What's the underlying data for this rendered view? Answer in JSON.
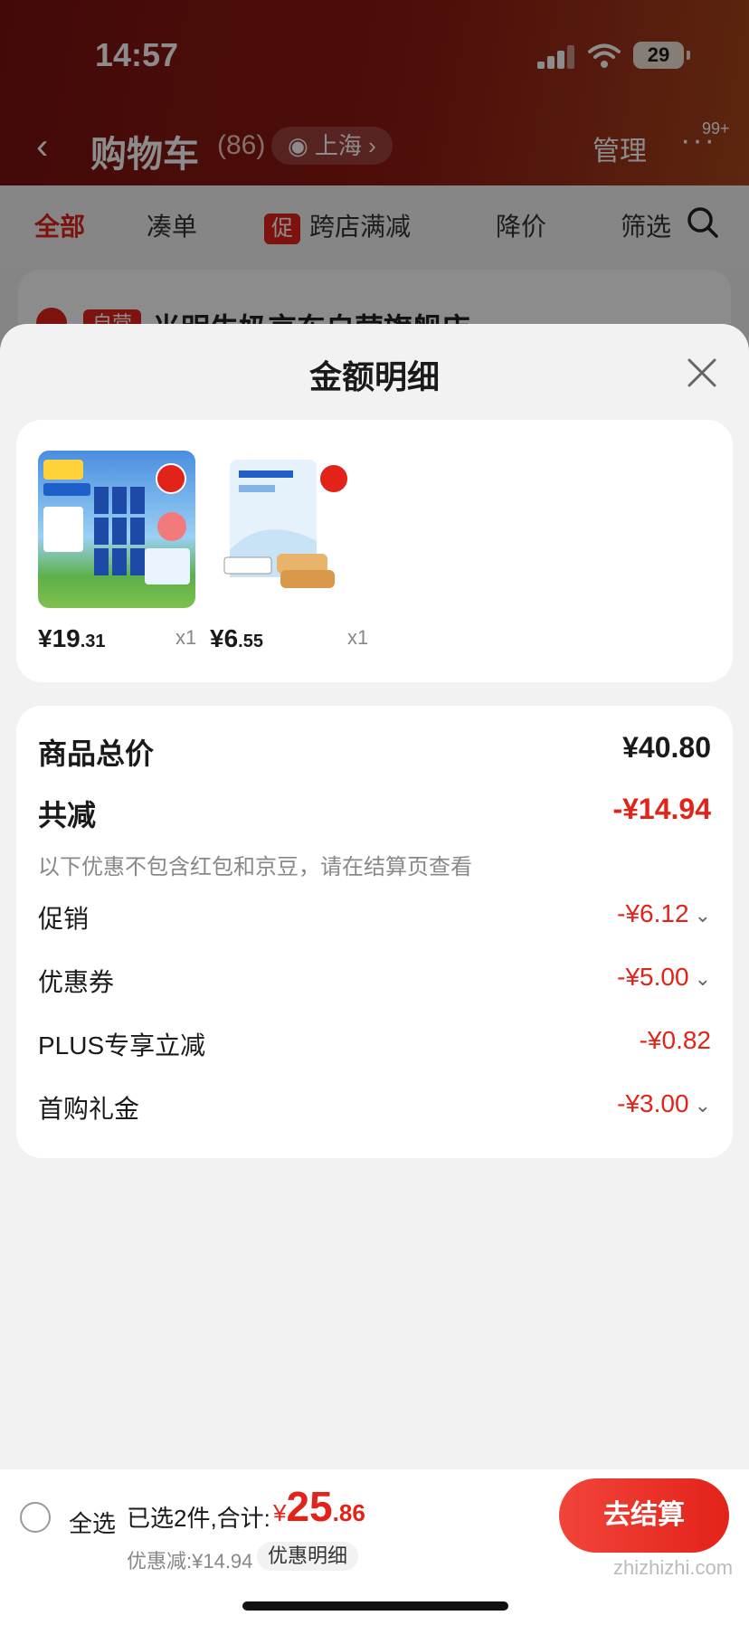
{
  "status": {
    "time": "14:57",
    "battery": "29"
  },
  "cart_header": {
    "title": "购物车",
    "count": "(86)",
    "location": "上海",
    "manage": "管理",
    "badge": "99+"
  },
  "filters": {
    "all": "全部",
    "bundle": "凑单",
    "promo_icon": "促",
    "cross_store": "跨店满减",
    "price_drop": "降价",
    "filter": "筛选"
  },
  "store": {
    "tag": "自营",
    "name": "光明牛奶京东自营旗舰店"
  },
  "sheet": {
    "title": "金额明细",
    "products": [
      {
        "price_int": "¥19",
        "price_dec": ".31",
        "qty": "x1"
      },
      {
        "price_int": "¥6",
        "price_dec": ".55",
        "qty": "x1"
      }
    ],
    "summary": {
      "goods_total_label": "商品总价",
      "goods_total_value": "¥40.80",
      "total_reduce_label": "共减",
      "total_reduce_value": "-¥14.94",
      "note": "以下优惠不包含红包和京豆，请在结算页查看",
      "rows": [
        {
          "label": "促销",
          "value": "-¥6.12"
        },
        {
          "label": "优惠券",
          "value": "-¥5.00"
        },
        {
          "label": "PLUS专享立减",
          "value": "-¥0.82"
        },
        {
          "label": "首购礼金",
          "value": "-¥3.00"
        }
      ]
    }
  },
  "bottom": {
    "select_all": "全选",
    "selected": "已选2件,合计:",
    "total_currency": "¥",
    "total_int": "25",
    "total_dec": ".86",
    "discount": "优惠减:¥14.94",
    "detail": "优惠明细",
    "checkout": "去结算",
    "watermark": "zhizhizhi.com"
  },
  "colors": {
    "accent": "#e2231a",
    "header": "#8e1a12"
  }
}
